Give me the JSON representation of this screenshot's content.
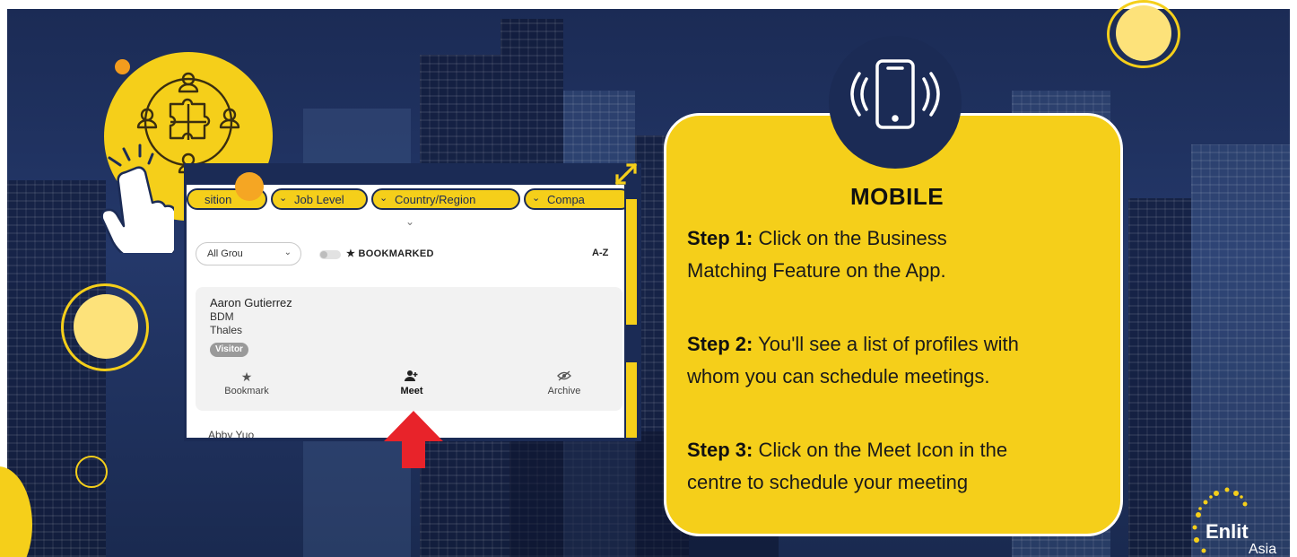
{
  "colors": {
    "background_navy": "#1b2b55",
    "accent_yellow": "#f5cf1a",
    "orange": "#f39c1e",
    "arrow_red": "#e8232a",
    "card_white": "#ffffff"
  },
  "icons": {
    "puzzle": "puzzle-network-icon",
    "hand": "pointing-hand-icon",
    "expand": "expand-arrows-icon",
    "phone": "vibrating-phone-icon",
    "arrow": "red-up-arrow-icon"
  },
  "app": {
    "filters": [
      "sition",
      "Job Level",
      "Country/Region",
      "Compa"
    ],
    "group_select": "All Grou",
    "bookmarked_label": "★ BOOKMARKED",
    "sort_label": "A-Z",
    "profile": {
      "name": "Aaron Gutierrez",
      "role": "BDM",
      "company": "Thales",
      "badge": "Visitor"
    },
    "actions": {
      "bookmark": "Bookmark",
      "meet": "Meet",
      "archive": "Archive"
    },
    "next_profile_name": "Abby Yuo"
  },
  "mobile": {
    "title": "MOBILE",
    "steps": [
      {
        "label": "Step 1:",
        "line1": " Click on the Business",
        "line2": "Matching Feature on the App."
      },
      {
        "label": "Step 2:",
        "line1": " You'll see a list of profiles with",
        "line2": "whom you can schedule meetings."
      },
      {
        "label": "Step 3:",
        "line1": " Click on the Meet Icon in the",
        "line2": "centre to schedule your meeting"
      }
    ]
  },
  "logo": {
    "name": "Enlit",
    "sub": "Asia"
  }
}
